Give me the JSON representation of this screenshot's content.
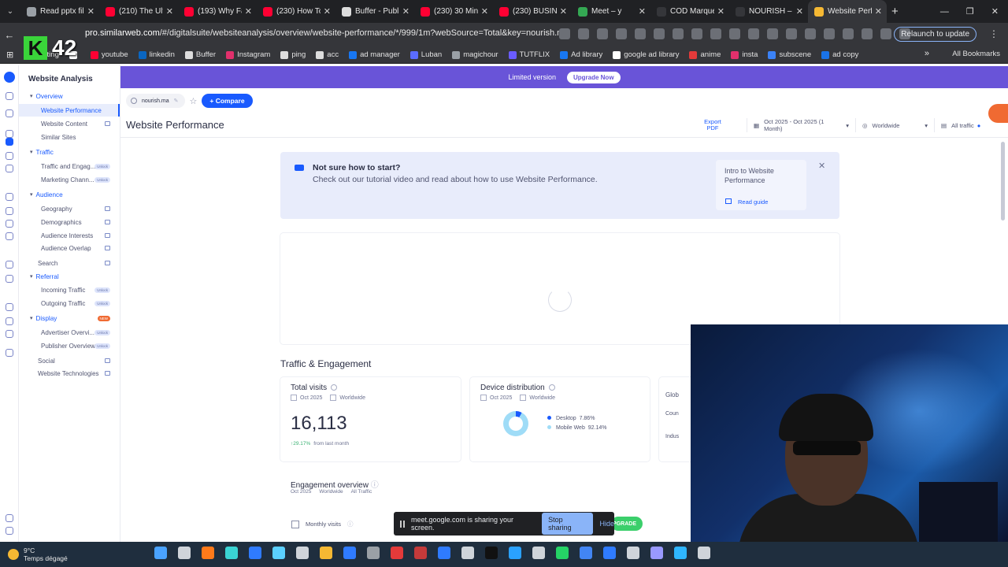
{
  "browser": {
    "tabs": [
      {
        "title": "Read pptx file",
        "color": "#9aa0a6",
        "active": false
      },
      {
        "title": "(210) The Ulti",
        "color": "#ff0033",
        "active": false
      },
      {
        "title": "(193) Why Fa",
        "color": "#ff0033",
        "active": false
      },
      {
        "title": "(230) How To",
        "color": "#ff0033",
        "active": false
      },
      {
        "title": "Buffer - Publi",
        "color": "#dddddd",
        "active": false
      },
      {
        "title": "(230) 30 Min",
        "color": "#ff0033",
        "active": false
      },
      {
        "title": "(230) BUSINE",
        "color": "#ff0033",
        "active": false
      },
      {
        "title": "Meet – y",
        "color": "#34a853",
        "active": false
      },
      {
        "title": "COD Marque",
        "color": "#35363a",
        "active": false
      },
      {
        "title": "NOURISH – S",
        "color": "#35363a",
        "active": false
      },
      {
        "title": "Website Perfo",
        "color": "#f5b833",
        "active": true
      }
    ],
    "url_host": "pro.similarweb.com",
    "url_path": "/#/digitalsuite/websiteanalysis/overview/website-performance/*/999/1m?webSource=Total&key=nourish.ma",
    "relaunch_label": "Relaunch to update",
    "bookmarks": [
      {
        "label": "posting",
        "color": "#8ab4f8"
      },
      {
        "label": "",
        "color": "#ffffff"
      },
      {
        "label": "youtube",
        "color": "#ff0033"
      },
      {
        "label": "linkedin",
        "color": "#0a66c2"
      },
      {
        "label": "Buffer",
        "color": "#dddddd"
      },
      {
        "label": "Instagram",
        "color": "#e1306c"
      },
      {
        "label": "ping",
        "color": "#dddddd"
      },
      {
        "label": "acc",
        "color": "#dddddd"
      },
      {
        "label": "ad manager",
        "color": "#1877f2"
      },
      {
        "label": "Luban",
        "color": "#5b6cff"
      },
      {
        "label": "magichour",
        "color": "#9aa0a6"
      },
      {
        "label": "TUTFLIX",
        "color": "#6a5cff"
      },
      {
        "label": "Ad library",
        "color": "#1877f2"
      },
      {
        "label": "google ad library",
        "color": "#ffffff"
      },
      {
        "label": "anime",
        "color": "#e33a3a"
      },
      {
        "label": "insta",
        "color": "#e1306c"
      },
      {
        "label": "subscene",
        "color": "#3b82f6"
      },
      {
        "label": "ad copy",
        "color": "#1a73e8"
      }
    ],
    "all_bookmarks_label": "All Bookmarks",
    "overlay_badge": "42"
  },
  "app": {
    "sidebar_title": "Website Analysis",
    "sidebar_items": [
      {
        "label": "Overview",
        "type": "section",
        "top": 0
      },
      {
        "label": "Website Performance",
        "type": "active"
      },
      {
        "label": "Website Content",
        "type": "lock"
      },
      {
        "label": "Similar Sites",
        "type": "plain"
      },
      {
        "label": "Traffic",
        "type": "section"
      },
      {
        "label": "Traffic and Engag...",
        "type": "unlock"
      },
      {
        "label": "Marketing Chann...",
        "type": "unlock"
      },
      {
        "label": "Audience",
        "type": "section"
      },
      {
        "label": "Geography",
        "type": "lock"
      },
      {
        "label": "Demographics",
        "type": "lock"
      },
      {
        "label": "Audience Interests",
        "type": "lock"
      },
      {
        "label": "Audience Overlap",
        "type": "lock"
      },
      {
        "label": "Search",
        "type": "searchsec"
      },
      {
        "label": "Referral",
        "type": "section"
      },
      {
        "label": "Incoming Traffic",
        "type": "unlock"
      },
      {
        "label": "Outgoing Traffic",
        "type": "unlock"
      },
      {
        "label": "Display",
        "type": "sectionnew"
      },
      {
        "label": "Advertiser Overvi...",
        "type": "unlock"
      },
      {
        "label": "Publisher Overview",
        "type": "unlock"
      },
      {
        "label": "Social",
        "type": "searchsec"
      },
      {
        "label": "Website Technologies",
        "type": "searchsec"
      }
    ],
    "unlock_label": "Unlock",
    "new_label": "NEW",
    "banner": {
      "limited": "Limited version",
      "upgrade": "Upgrade Now"
    },
    "domain": "nourish.ma",
    "compare_label": "+ Compare",
    "page_title": "Website Performance",
    "export_label": "Export PDF",
    "date_range": "Oct 2025 - Oct 2025 (1 Month)",
    "geo": "Worldwide",
    "traffic": "All traffic",
    "tutorial": {
      "heading": "Not sure how to start?",
      "text": "Check out our tutorial video and read about how to use Website Performance.",
      "card_title": "Intro to Website Performance",
      "read_guide": "Read guide"
    },
    "section_title": "Traffic & Engagement",
    "total_visits": {
      "title": "Total visits",
      "month": "Oct 2025",
      "geo": "Worldwide",
      "value": "16,113",
      "change": "↑29.17%",
      "change_note": "from last month"
    },
    "device": {
      "title": "Device distribution",
      "month": "Oct 2025",
      "geo": "Worldwide",
      "desktop_label": "Desktop",
      "desktop_value": "7.86%",
      "mobile_label": "Mobile Web",
      "mobile_value": "92.14%",
      "desktop_color": "#195afe",
      "mobile_color": "#9fdcf7"
    },
    "global_card": {
      "l1": "Glob",
      "l2": "Coun",
      "l3": "Indus"
    },
    "engagement": {
      "title": "Engagement overview",
      "month": "Oct 2025",
      "geo": "Worldwide",
      "traffic": "All Traffic",
      "monthly_visits": "Monthly visits"
    },
    "upgrade_pill": "UPGRADE"
  },
  "share_bar": {
    "message": "meet.google.com is sharing your screen.",
    "stop": "Stop sharing",
    "hide": "Hide"
  },
  "taskbar": {
    "temp": "9°C",
    "weather": "Temps dégagé",
    "icon_colors": [
      "#4aa3ff",
      "#cfd4da",
      "#ff7a1a",
      "#3ad4d4",
      "#2f7bff",
      "#5bd0ff",
      "#cfd4da",
      "#f5b833",
      "#2f7bff",
      "#9aa0a6",
      "#e33a3a",
      "#c43a3a",
      "#2f7bff",
      "#cfd4da",
      "#111111",
      "#2aa1ff",
      "#cfd4da",
      "#25d366",
      "#4285f4",
      "#2f7bff",
      "#cfd4da",
      "#9999ff",
      "#2fb6ff",
      "#cfd4da"
    ]
  }
}
